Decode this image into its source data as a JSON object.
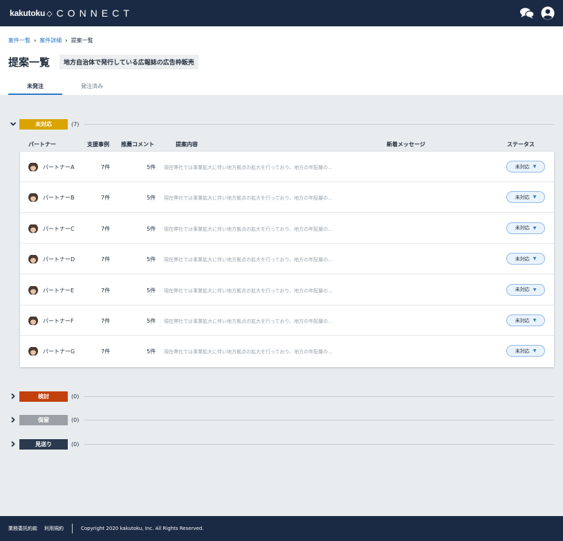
{
  "app": {
    "brand": "kakutoku",
    "brand_mark": "◇",
    "product": "CONNECT"
  },
  "breadcrumb": {
    "items": [
      "案件一覧",
      "案件詳細"
    ],
    "separator": "›",
    "current": "提案一覧"
  },
  "page": {
    "title": "提案一覧",
    "project_name": "地方自治体で発行している広報誌の広告枠販売"
  },
  "tabs": [
    {
      "label": "未発注",
      "active": true
    },
    {
      "label": "発注済み",
      "active": false
    }
  ],
  "table": {
    "headers": {
      "partner": "パートナー",
      "cases": "支援事例",
      "comments": "推薦コメント",
      "content": "提案内容",
      "message": "新着メッセージ",
      "status": "ステータス"
    },
    "rows": [
      {
        "partner": "パートナーA",
        "cases": "7件",
        "comments": "5件",
        "content": "現在弊社では事業拡大に伴い地方拠点の拡大を行っており、地方の年配層の...",
        "status": "未対応"
      },
      {
        "partner": "パートナーB",
        "cases": "7件",
        "comments": "5件",
        "content": "現在弊社では事業拡大に伴い地方拠点の拡大を行っており、地方の年配層の...",
        "status": "未対応"
      },
      {
        "partner": "パートナーC",
        "cases": "7件",
        "comments": "5件",
        "content": "現在弊社では事業拡大に伴い地方拠点の拡大を行っており、地方の年配層の...",
        "status": "未対応"
      },
      {
        "partner": "パートナーD",
        "cases": "7件",
        "comments": "5件",
        "content": "現在弊社では事業拡大に伴い地方拠点の拡大を行っており、地方の年配層の...",
        "status": "未対応"
      },
      {
        "partner": "パートナーE",
        "cases": "7件",
        "comments": "5件",
        "content": "現在弊社では事業拡大に伴い地方拠点の拡大を行っており、地方の年配層の...",
        "status": "未対応"
      },
      {
        "partner": "パートナーF",
        "cases": "7件",
        "comments": "5件",
        "content": "現在弊社では事業拡大に伴い地方拠点の拡大を行っており、地方の年配層の...",
        "status": "未対応"
      },
      {
        "partner": "パートナーG",
        "cases": "7件",
        "comments": "5件",
        "content": "現在弊社では事業拡大に伴い地方拠点の拡大を行っており、地方の年配層の...",
        "status": "未対応"
      }
    ]
  },
  "groups": [
    {
      "label": "未対応",
      "count": "(7)",
      "expanded": true,
      "color": "#d9a400"
    },
    {
      "label": "検討",
      "count": "(0)",
      "expanded": false,
      "color": "#c2410c"
    },
    {
      "label": "保留",
      "count": "(0)",
      "expanded": false,
      "color": "#9aa0a6"
    },
    {
      "label": "見送り",
      "count": "(0)",
      "expanded": false,
      "color": "#2b3a4e"
    }
  ],
  "footer": {
    "links": [
      "業務委託約款",
      "利用規約"
    ],
    "copyright": "Copyright 2020 kakutoku, Inc. All Rights Reserved."
  },
  "icons": {
    "chat": "chat-bubbles-icon",
    "user": "user-circle-icon",
    "expand": "chevron-down-icon",
    "collapse": "chevron-right-icon",
    "status_caret": "caret-down-icon"
  },
  "colors": {
    "navy": "#1b2a44",
    "link_blue": "#2a79c9",
    "page_bg": "#e9ecef"
  }
}
